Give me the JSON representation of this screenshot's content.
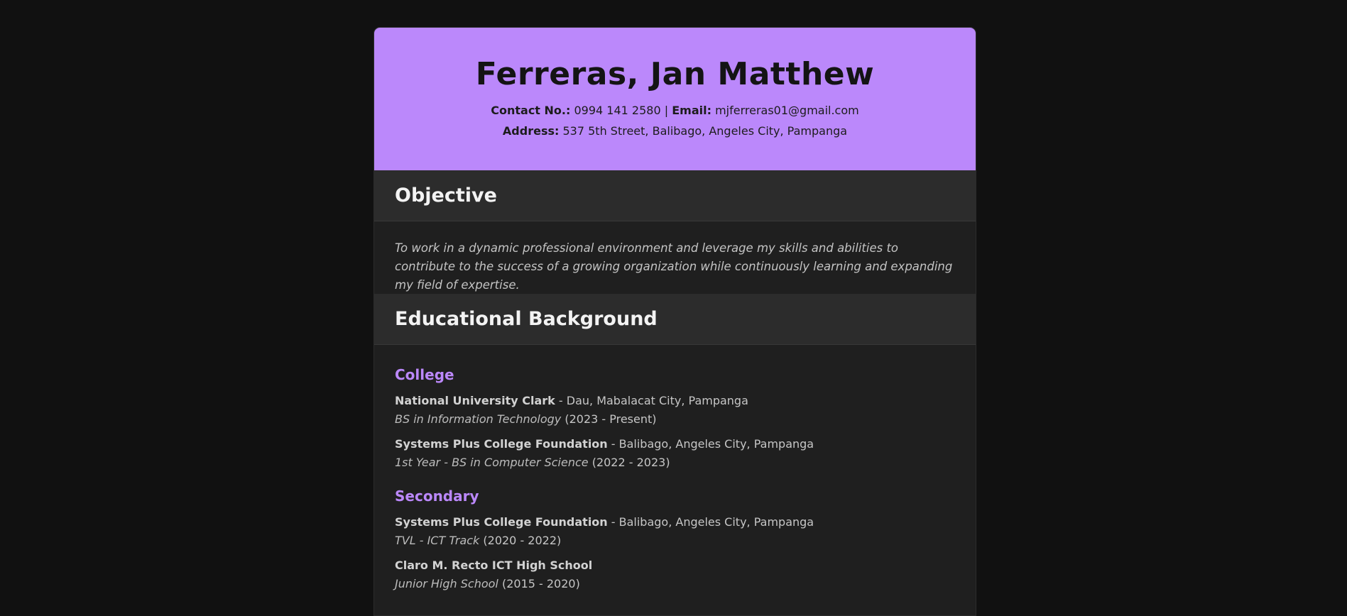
{
  "header": {
    "name": "Ferreras, Jan Matthew",
    "contact_label": "Contact No.:",
    "contact_value": "0994 141 2580",
    "separator": "|",
    "email_label": "Email:",
    "email_value": "mjferreras01@gmail.com",
    "address_label": "Address:",
    "address_value": "537 5th Street, Balibago, Angeles City, Pampanga"
  },
  "objective": {
    "title": "Objective",
    "text": "To work in a dynamic professional environment and leverage my skills and abilities to contribute to the success of a growing organization while continuously learning and expanding my field of expertise."
  },
  "education": {
    "title": "Educational Background",
    "college": {
      "label": "College",
      "entries": [
        {
          "school": "National University Clark",
          "location": " - Dau, Mabalacat City, Pampanga",
          "course": "BS in Information Technology",
          "years": " (2023 - Present)"
        },
        {
          "school": "Systems Plus College Foundation",
          "location": " - Balibago, Angeles City, Pampanga",
          "course": "1st Year - BS in Computer Science",
          "years": " (2022 - 2023)"
        }
      ]
    },
    "secondary": {
      "label": "Secondary",
      "entries": [
        {
          "school": "Systems Plus College Foundation",
          "location": " - Balibago, Angeles City, Pampanga",
          "course": "TVL - ICT Track",
          "years": " (2020 - 2022)"
        },
        {
          "school": "Claro M. Recto ICT High School",
          "location": "",
          "course": "Junior High School",
          "years": " (2015 - 2020)"
        }
      ]
    }
  },
  "colors": {
    "accent": "#bb88fb",
    "background": "#111111",
    "card": "#1f1f1f",
    "section_header": "#2c2c2c"
  }
}
